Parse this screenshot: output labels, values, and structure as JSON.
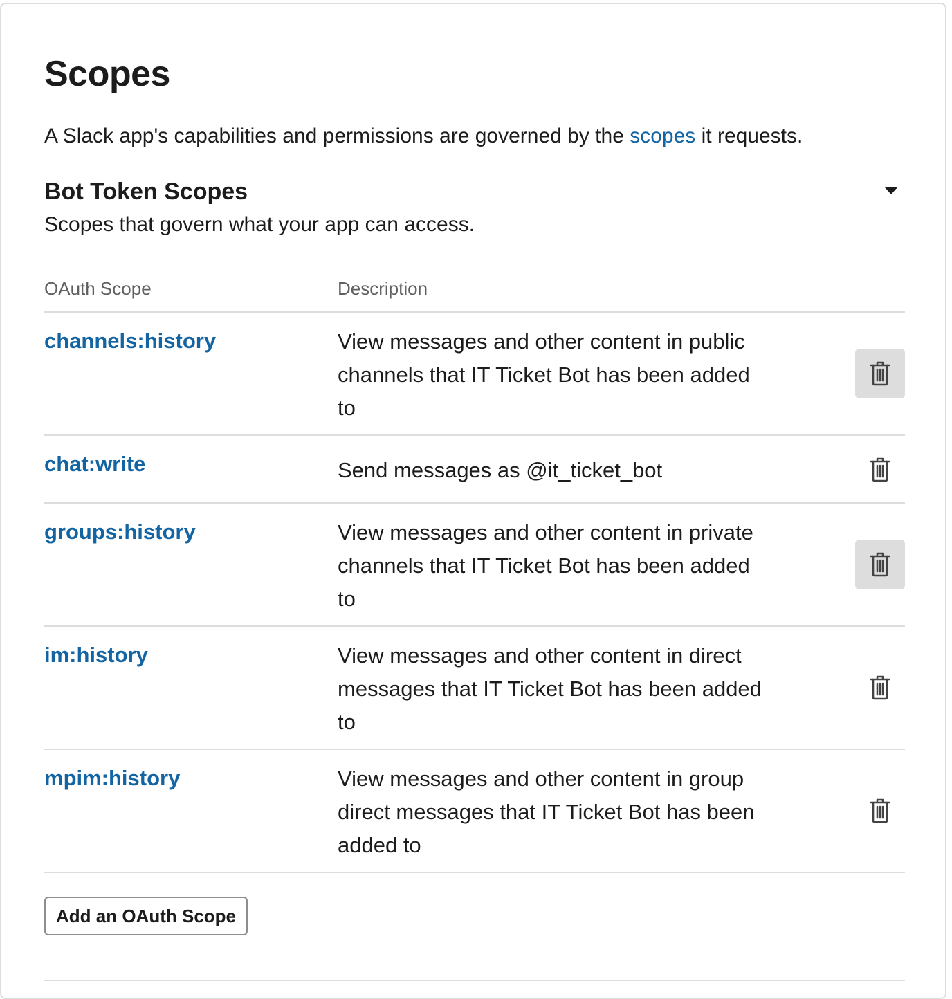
{
  "page": {
    "title": "Scopes",
    "intro_before": "A Slack app's capabilities and permissions are governed by the ",
    "intro_link": "scopes",
    "intro_after": " it requests."
  },
  "section": {
    "title": "Bot Token Scopes",
    "subtitle": "Scopes that govern what your app can access.",
    "toggle_icon": "caret-down-icon"
  },
  "table": {
    "headers": [
      "OAuth Scope",
      "Description"
    ],
    "rows": [
      {
        "scope": "channels:history",
        "description": "View messages and other content in public channels that IT Ticket Bot has been added to",
        "remove_icon": "trash-icon"
      },
      {
        "scope": "chat:write",
        "description": "Send messages as @it_ticket_bot",
        "remove_icon": "trash-icon"
      },
      {
        "scope": "groups:history",
        "description": "View messages and other content in private channels that IT Ticket Bot has been added to",
        "remove_icon": "trash-icon"
      },
      {
        "scope": "im:history",
        "description": "View messages and other content in direct messages that IT Ticket Bot has been added to",
        "remove_icon": "trash-icon"
      },
      {
        "scope": "mpim:history",
        "description": "View messages and other content in group direct messages that IT Ticket Bot has been added to",
        "remove_icon": "trash-icon"
      }
    ]
  },
  "actions": {
    "add_scope_label": "Add an OAuth Scope"
  },
  "colors": {
    "link": "#1264a3",
    "text": "#1d1c1d",
    "muted": "#616061",
    "divider": "#dddddd",
    "icon_hover_bg": "#dddddd"
  }
}
